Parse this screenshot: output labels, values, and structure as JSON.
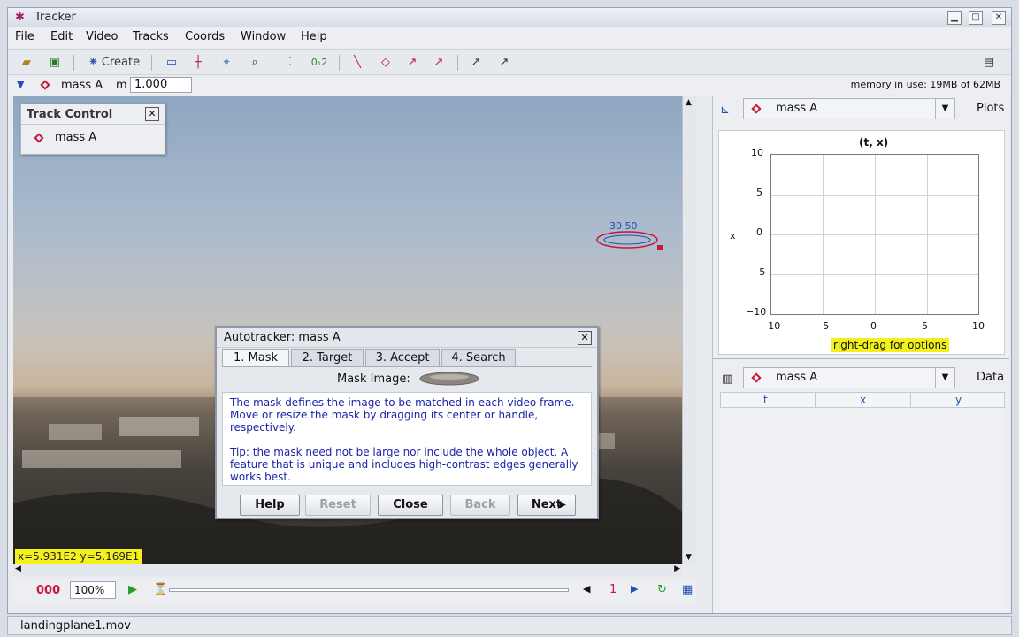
{
  "window": {
    "title": "Tracker"
  },
  "menu": [
    "File",
    "Edit",
    "Video",
    "Tracks",
    "Coords",
    "Window",
    "Help"
  ],
  "toolbar": {
    "create_label": "Create"
  },
  "trackbar": {
    "track_name": "mass A",
    "mass_label": "m",
    "mass_value": "1.000",
    "memory": "memory in use: 19MB of 62MB"
  },
  "track_control": {
    "title": "Track Control",
    "item": "mass A"
  },
  "video": {
    "marker_label": "30 50",
    "coords": "x=5.931E2 y=5.169E1"
  },
  "player": {
    "frame": "000",
    "zoom": "100%",
    "step": "1"
  },
  "plot": {
    "track": "mass A",
    "button": "Plots",
    "chart_title": "(t, x)",
    "ylabel": "x",
    "yticks": [
      "10",
      "5",
      "0",
      "−5",
      "−10"
    ],
    "xticks": [
      "−10",
      "−5",
      "0",
      "5",
      "10"
    ],
    "hint": "right-drag for options"
  },
  "table": {
    "track": "mass A",
    "button": "Data",
    "columns": [
      "t",
      "x",
      "y"
    ]
  },
  "dialog": {
    "title": "Autotracker: mass A",
    "tabs": [
      "1. Mask",
      "2. Target",
      "3. Accept",
      "4. Search"
    ],
    "mask_label": "Mask Image:",
    "text1": "The mask defines the image to be matched in each video frame. Move or resize the mask by dragging its center or handle, respectively.",
    "text2": "Tip: the mask need not be large nor include the whole object. A feature that is unique and includes high-contrast edges generally works best.",
    "buttons": {
      "help": "Help",
      "reset": "Reset",
      "close": "Close",
      "back": "Back",
      "next": "Next"
    }
  },
  "status": {
    "file": "landingplane1.mov"
  }
}
